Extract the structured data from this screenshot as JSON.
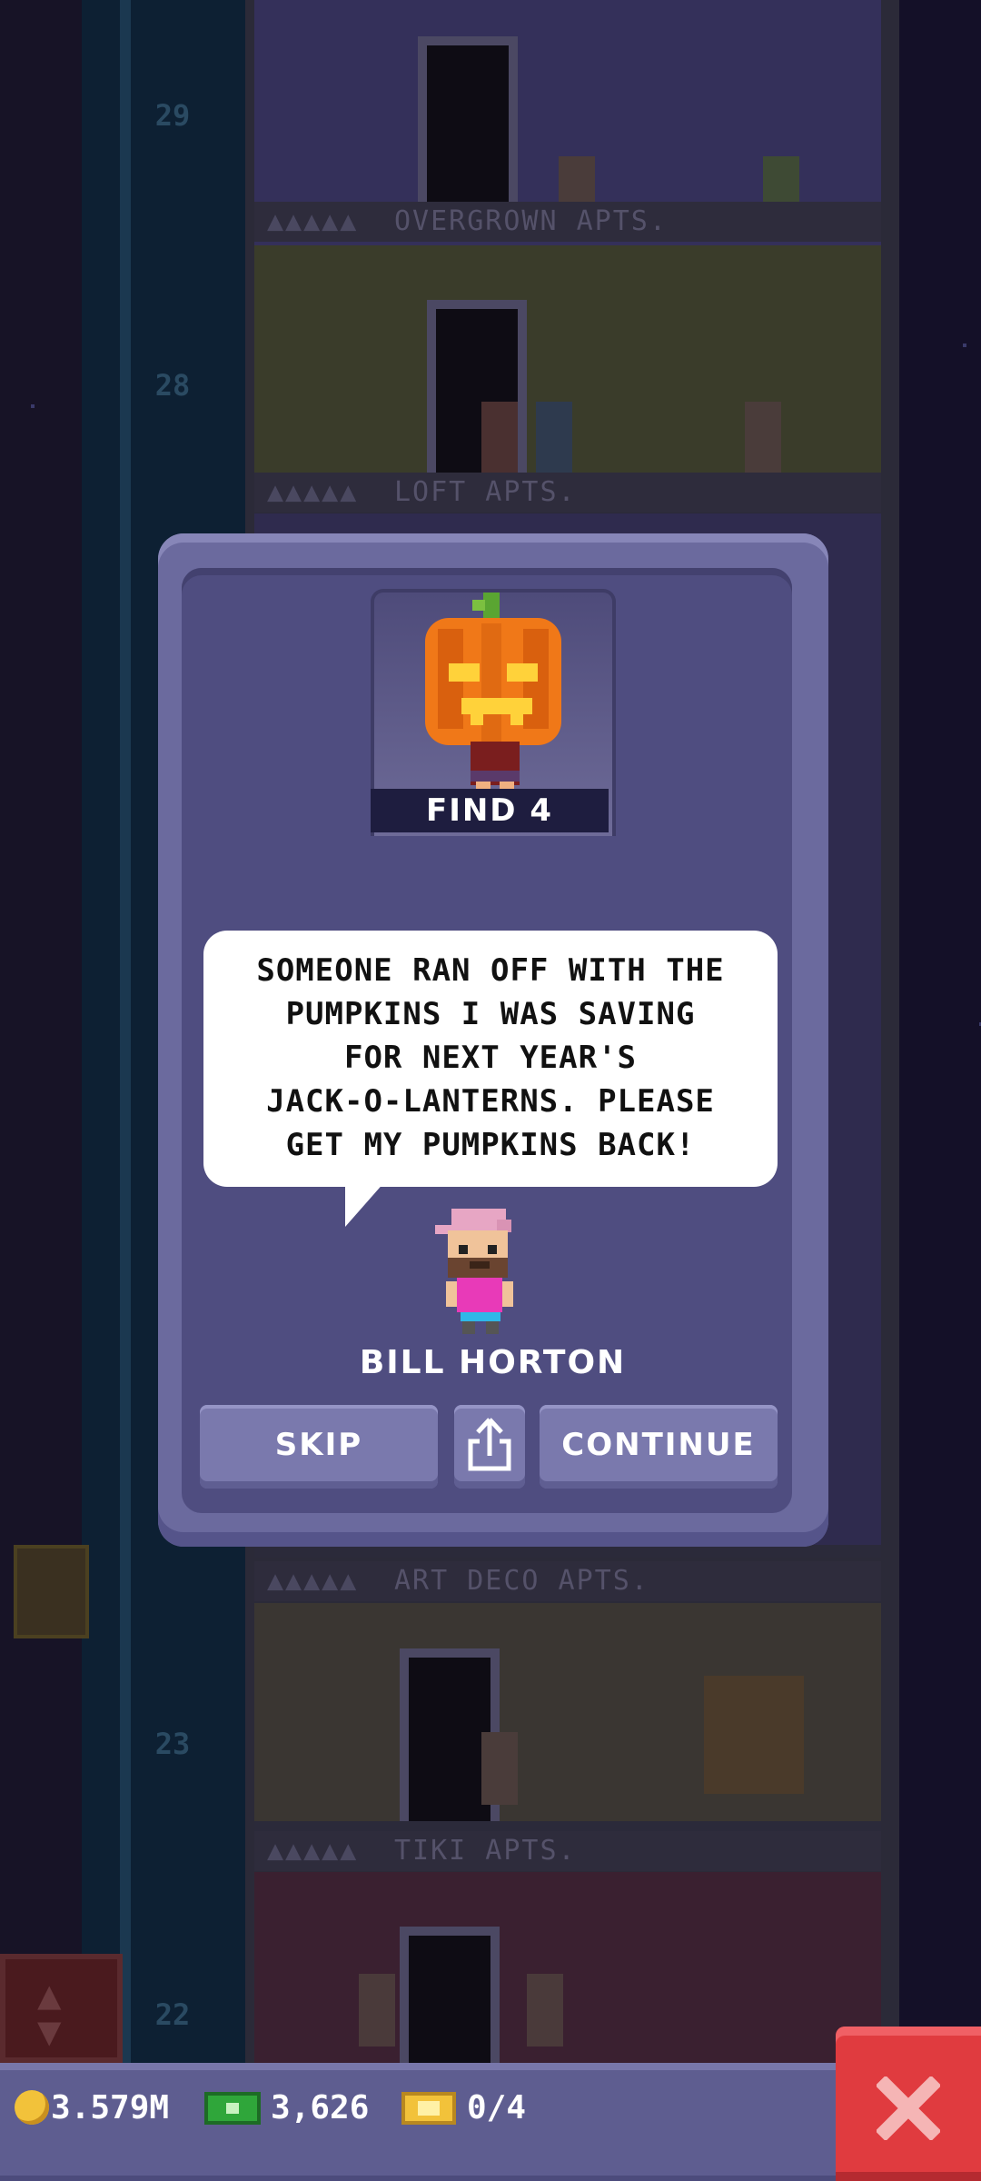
{
  "background": {
    "floors": [
      {
        "number": "29",
        "label": ""
      },
      {
        "number": "",
        "label": "OVERGROWN APTS."
      },
      {
        "number": "28",
        "label": ""
      },
      {
        "number": "",
        "label": "LOFT APTS."
      },
      {
        "number": "",
        "label": "ART DECO APTS."
      },
      {
        "number": "23",
        "label": ""
      },
      {
        "number": "",
        "label": "TIKI APTS."
      },
      {
        "number": "22",
        "label": ""
      }
    ],
    "label_dots": "▲▲▲▲▲"
  },
  "mission": {
    "find_label": "FIND 4",
    "speech_lines": [
      "SOMEONE RAN OFF WITH THE",
      "PUMPKINS I WAS SAVING",
      "FOR NEXT YEAR'S",
      "JACK-O-LANTERNS. PLEASE",
      "GET MY PUMPKINS BACK!"
    ],
    "character_name": "BILL HORTON",
    "buttons": {
      "skip": "SKIP",
      "continue": "CONTINUE"
    }
  },
  "hud": {
    "coins": "3.579M",
    "bux": "3,626",
    "tickets": "0/4"
  },
  "icons": {
    "coin": "coin-icon",
    "bux": "tower-bux-icon",
    "ticket": "golden-ticket-icon",
    "share": "share-icon",
    "close": "close-icon",
    "elevator_arrows": "elevator-arrows-icon"
  },
  "colors": {
    "modal_frame": "#6b6a9e",
    "modal_body": "#4f4d80",
    "button": "#7a79ad",
    "close": "#e03b3f",
    "hud": "#5e5d90"
  }
}
